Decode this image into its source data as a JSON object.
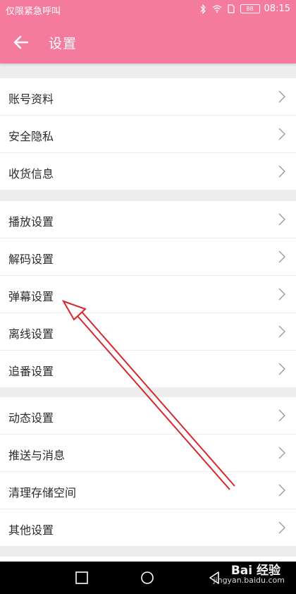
{
  "status_bar": {
    "carrier_text": "仅限紧急呼叫",
    "battery": "88",
    "time": "08:15"
  },
  "app_bar": {
    "title": "设置"
  },
  "groups": [
    {
      "items": [
        {
          "label": "账号资料"
        },
        {
          "label": "安全隐私"
        },
        {
          "label": "收货信息"
        }
      ]
    },
    {
      "items": [
        {
          "label": "播放设置"
        },
        {
          "label": "解码设置"
        },
        {
          "label": "弹幕设置"
        },
        {
          "label": "离线设置"
        },
        {
          "label": "追番设置"
        }
      ]
    },
    {
      "items": [
        {
          "label": "动态设置"
        },
        {
          "label": "推送与消息"
        },
        {
          "label": "清理存储空间"
        },
        {
          "label": "其他设置"
        }
      ]
    }
  ],
  "watermark": {
    "brand": "Bai 经验",
    "url": "jingyan.baidu.com"
  },
  "colors": {
    "accent": "#f57b9e",
    "annotation_arrow": "#d9262b"
  }
}
